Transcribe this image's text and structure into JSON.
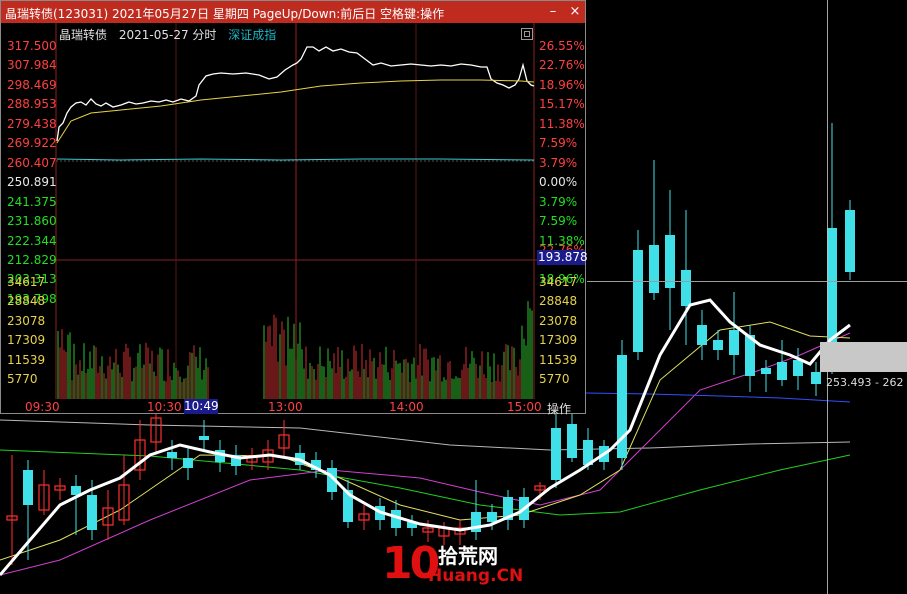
{
  "window": {
    "title": "晶瑞转债(123031) 2021年05月27日 星期四 PageUp/Down:前后日 空格键:操作",
    "minimize_glyph": "–",
    "close_glyph": "×"
  },
  "header": {
    "name": "晶瑞转债",
    "date_mode": "2021-05-27 分时",
    "index_link": "深证成指"
  },
  "price_axis": [
    {
      "left": "317.500",
      "right": "26.55%",
      "kind": "up"
    },
    {
      "left": "307.984",
      "right": "22.76%",
      "kind": "up"
    },
    {
      "left": "298.469",
      "right": "18.96%",
      "kind": "up"
    },
    {
      "left": "288.953",
      "right": "15.17%",
      "kind": "up"
    },
    {
      "left": "279.438",
      "right": "11.38%",
      "kind": "up"
    },
    {
      "left": "269.922",
      "right": "7.59%",
      "kind": "up"
    },
    {
      "left": "260.407",
      "right": "3.79%",
      "kind": "up"
    },
    {
      "left": "250.891",
      "right": "0.00%",
      "kind": "flat"
    },
    {
      "left": "241.375",
      "right": "3.79%",
      "kind": "down"
    },
    {
      "left": "231.860",
      "right": "7.59%",
      "kind": "down"
    },
    {
      "left": "222.344",
      "right": "11.38%",
      "kind": "down"
    },
    {
      "left": "212.829",
      "right": "15.17%",
      "kind": "down"
    },
    {
      "left": "203.313",
      "right": "18.96%",
      "kind": "down"
    },
    {
      "left": "193.798",
      "right": "",
      "kind": "down"
    }
  ],
  "hover_price": "193.878",
  "hover_pct_partial": "22.76%",
  "volume_axis": [
    "34617",
    "28848",
    "23078",
    "17309",
    "11539",
    "5770"
  ],
  "time_axis": {
    "labels": [
      "09:30",
      "10:30",
      "13:00",
      "14:00",
      "15:00"
    ],
    "cursor": "10:49",
    "operate": "操作"
  },
  "background": {
    "price_label": "253.493 - 262"
  },
  "watermark": {
    "digits": "10",
    "cn": "拾荒网",
    "en": "Huang.CN"
  },
  "colors": {
    "title_bar": "#bf2b1e",
    "up": "#ff4040",
    "down": "#20e020",
    "price_line": "#ffffff",
    "avg_line": "#e6d34a",
    "bg_candle_down": "#40e0e8",
    "bg_candle_up": "#ff3030",
    "index_link": "#1ab6c6"
  }
}
